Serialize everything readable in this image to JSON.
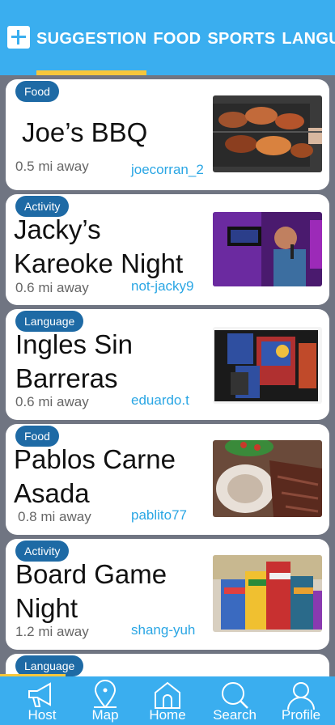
{
  "header": {
    "tabs": [
      "SUGGESTION",
      "FOOD",
      "SPORTS",
      "LANGUAGE"
    ]
  },
  "cards": [
    {
      "badge": "Food",
      "title_lines": [
        "Joe’s BBQ"
      ],
      "distance": "0.5 mi away",
      "host": "joecorran_2"
    },
    {
      "badge": "Activity",
      "title_lines": [
        "Jacky’s",
        "Kareoke Night"
      ],
      "distance": "0.6 mi away",
      "host": "not-jacky9"
    },
    {
      "badge": "Language",
      "title_lines": [
        "Ingles Sin",
        "Barreras"
      ],
      "distance": "0.6 mi away",
      "host": "eduardo.t"
    },
    {
      "badge": "Food",
      "title_lines": [
        "Pablos Carne",
        "Asada"
      ],
      "distance": "0.8 mi away",
      "host": "pablito77"
    },
    {
      "badge": "Activity",
      "title_lines": [
        "Board Game",
        "Night"
      ],
      "distance": "1.2 mi away",
      "host": "shang-yuh"
    },
    {
      "badge": "Language"
    }
  ],
  "nav": {
    "items": [
      "Host",
      "Map",
      "Home",
      "Search",
      "Profile"
    ]
  },
  "colors": {
    "primary": "#3aaeef",
    "accent": "#f6c73b",
    "badge": "#1e6aa5",
    "host_text": "#2aa6e4",
    "background": "#707582"
  },
  "icons": [
    "plus-icon",
    "megaphone-icon",
    "map-pin-icon",
    "home-icon",
    "search-icon",
    "profile-icon"
  ]
}
